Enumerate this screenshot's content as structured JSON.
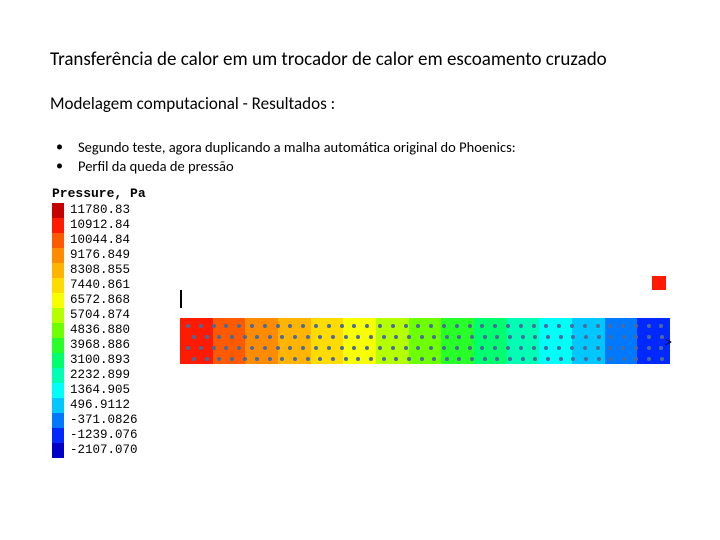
{
  "title": "Transferência de calor em um trocador de calor em escoamento cruzado",
  "subtitle": "Modelagem computacional - Resultados :",
  "bullets": [
    "Segundo teste, agora duplicando a malha automática original do Phoenics:",
    "Perfil da queda de pressão"
  ],
  "legend": {
    "title": "Pressure, Pa",
    "values": [
      "11780.83",
      "10912.84",
      "10044.84",
      "9176.849",
      "8308.855",
      "7440.861",
      "6572.868",
      "5704.874",
      "4836.880",
      "3968.886",
      "3100.893",
      "2232.899",
      "1364.905",
      "496.9112",
      "-371.0826",
      "-1239.076",
      "-2107.070"
    ],
    "colors": [
      "#c40000",
      "#ff1a00",
      "#ff5a00",
      "#ff8c00",
      "#ffb400",
      "#ffdc00",
      "#f7ff00",
      "#b4ff00",
      "#6eff00",
      "#28ff28",
      "#00ff6e",
      "#00ffb4",
      "#00fff7",
      "#00c8ff",
      "#0078ff",
      "#0028ff",
      "#0000c8"
    ]
  },
  "chart_data": {
    "type": "heatmap",
    "title": "Pressure, Pa",
    "min": -2107.07,
    "max": 11780.83,
    "description": "Axial pressure drop along cross-flow heat exchanger; inlet (left) high pressure red, outlet (right) low pressure blue; staggered tube bank shown as dot rows"
  },
  "strip_gradient": [
    "#ff1a00",
    "#ff5a00",
    "#ff8c00",
    "#ffb400",
    "#ffdc00",
    "#f7ff00",
    "#b4ff00",
    "#6eff00",
    "#28ff28",
    "#00ff6e",
    "#00ffb4",
    "#00fff7",
    "#00c8ff",
    "#0078ff",
    "#0028ff"
  ],
  "dot_rows": {
    "count_per_row": 38,
    "rows": 4
  }
}
